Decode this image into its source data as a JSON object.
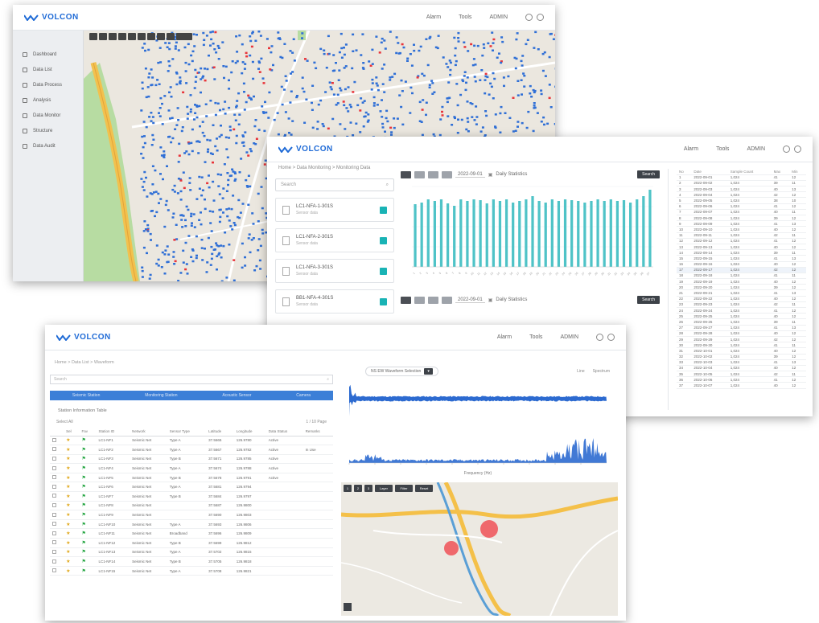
{
  "brand": {
    "logo_text": "VOLCON"
  },
  "header_links": [
    "Alarm",
    "Tools",
    "ADMIN"
  ],
  "window1": {
    "sidebar": [
      {
        "label": "Dashboard",
        "icon": "home-icon"
      },
      {
        "label": "Data List",
        "icon": "list-icon"
      },
      {
        "label": "Data Process",
        "icon": "process-icon"
      },
      {
        "label": "Analysis",
        "icon": "chart-icon"
      },
      {
        "label": "Data Monitor",
        "icon": "monitor-icon"
      },
      {
        "label": "Structure",
        "icon": "structure-icon"
      },
      {
        "label": "Data Audit",
        "icon": "audit-icon"
      }
    ]
  },
  "window2": {
    "breadcrumb": "Home  >  Data Monitoring  >  Monitoring Data",
    "search_placeholder": "Search",
    "cards": [
      {
        "title": "LC1-NFA-1-301S",
        "sub": "Sensor data"
      },
      {
        "title": "LC1-NFA-2-301S",
        "sub": "Sensor data"
      },
      {
        "title": "LC1-NFA-3-301S",
        "sub": "Sensor data"
      },
      {
        "title": "BB1-NFA-4-301S",
        "sub": "Sensor data"
      }
    ],
    "toolbar": {
      "select": "2022-09-01",
      "mode": "Daily Statistics",
      "button": "Search"
    },
    "toolbar2": {
      "select": "2022-09-01",
      "mode": "Daily Statistics",
      "button": "Search"
    },
    "table_headers": [
      "No",
      "Date",
      "Sample Count",
      "Max",
      "Min"
    ],
    "table_rows": [
      [
        "1",
        "2022-09-01",
        "1,024",
        "41",
        "12"
      ],
      [
        "2",
        "2022-09-02",
        "1,024",
        "39",
        "11"
      ],
      [
        "3",
        "2022-09-03",
        "1,024",
        "40",
        "13"
      ],
      [
        "4",
        "2022-09-04",
        "1,024",
        "42",
        "12"
      ],
      [
        "5",
        "2022-09-05",
        "1,024",
        "38",
        "10"
      ],
      [
        "6",
        "2022-09-06",
        "1,024",
        "41",
        "12"
      ],
      [
        "7",
        "2022-09-07",
        "1,024",
        "40",
        "11"
      ],
      [
        "8",
        "2022-09-08",
        "1,024",
        "39",
        "12"
      ],
      [
        "9",
        "2022-09-09",
        "1,024",
        "41",
        "13"
      ],
      [
        "10",
        "2022-09-10",
        "1,024",
        "40",
        "12"
      ],
      [
        "11",
        "2022-09-11",
        "1,024",
        "42",
        "11"
      ],
      [
        "12",
        "2022-09-12",
        "1,024",
        "41",
        "12"
      ],
      [
        "13",
        "2022-09-13",
        "1,024",
        "40",
        "12"
      ],
      [
        "14",
        "2022-09-14",
        "1,024",
        "39",
        "11"
      ],
      [
        "15",
        "2022-09-15",
        "1,024",
        "41",
        "13"
      ],
      [
        "16",
        "2022-09-16",
        "1,024",
        "40",
        "12"
      ],
      [
        "17",
        "2022-09-17",
        "1,024",
        "42",
        "12"
      ],
      [
        "18",
        "2022-09-18",
        "1,024",
        "41",
        "11"
      ],
      [
        "19",
        "2022-09-19",
        "1,024",
        "40",
        "12"
      ],
      [
        "20",
        "2022-09-20",
        "1,024",
        "39",
        "12"
      ],
      [
        "21",
        "2022-09-21",
        "1,024",
        "41",
        "13"
      ],
      [
        "22",
        "2022-09-22",
        "1,024",
        "40",
        "12"
      ],
      [
        "23",
        "2022-09-23",
        "1,024",
        "42",
        "11"
      ],
      [
        "24",
        "2022-09-24",
        "1,024",
        "41",
        "12"
      ],
      [
        "25",
        "2022-09-25",
        "1,024",
        "40",
        "12"
      ],
      [
        "26",
        "2022-09-26",
        "1,024",
        "39",
        "11"
      ],
      [
        "27",
        "2022-09-27",
        "1,024",
        "41",
        "13"
      ],
      [
        "28",
        "2022-09-28",
        "1,024",
        "40",
        "12"
      ],
      [
        "29",
        "2022-09-29",
        "1,024",
        "42",
        "12"
      ],
      [
        "30",
        "2022-09-30",
        "1,024",
        "41",
        "11"
      ],
      [
        "31",
        "2022-10-01",
        "1,024",
        "40",
        "12"
      ],
      [
        "32",
        "2022-10-02",
        "1,024",
        "39",
        "12"
      ],
      [
        "33",
        "2022-10-03",
        "1,024",
        "41",
        "13"
      ],
      [
        "34",
        "2022-10-04",
        "1,024",
        "40",
        "12"
      ],
      [
        "35",
        "2022-10-05",
        "1,024",
        "42",
        "11"
      ],
      [
        "36",
        "2022-10-06",
        "1,024",
        "41",
        "12"
      ],
      [
        "37",
        "2022-10-07",
        "1,024",
        "40",
        "12"
      ]
    ]
  },
  "chart_data": {
    "type": "bar",
    "categories": [
      "1",
      "2",
      "3",
      "4",
      "5",
      "6",
      "7",
      "8",
      "9",
      "10",
      "11",
      "12",
      "13",
      "14",
      "15",
      "16",
      "17",
      "18",
      "19",
      "20",
      "21",
      "22",
      "23",
      "24",
      "25",
      "26",
      "27",
      "28",
      "29",
      "30",
      "31",
      "32",
      "33",
      "34",
      "35",
      "36",
      "37"
    ],
    "values": [
      78,
      80,
      84,
      82,
      84,
      79,
      76,
      84,
      82,
      84,
      83,
      79,
      84,
      82,
      84,
      80,
      82,
      84,
      88,
      82,
      80,
      84,
      82,
      84,
      83,
      82,
      80,
      82,
      84,
      82,
      84,
      82,
      83,
      80,
      84,
      88,
      96
    ],
    "ylim": [
      0,
      100
    ],
    "color": "#4fc3c7"
  },
  "window3": {
    "breadcrumb": "Home  >  Data List  >  Waveform",
    "search_placeholder": "Search",
    "tabs": [
      "Seismic Station",
      "Monitoring Station",
      "Acoustic Sensor",
      "Camera"
    ],
    "section_title": "Station Information Table",
    "tools": {
      "left": "Select All",
      "right": "1 / 10 Page"
    },
    "table_headers": [
      "",
      "Sel",
      "Fav",
      "Station ID",
      "Network",
      "Sensor Type",
      "Latitude",
      "Longitude",
      "Data Status",
      "Remarks"
    ],
    "table_rows": [
      [
        "LC1-NF1",
        "Seismic Net",
        "Type A",
        "37.5665",
        "126.9780",
        "Active",
        ""
      ],
      [
        "LC1-NF2",
        "Seismic Net",
        "Type A",
        "37.5667",
        "126.9782",
        "Active",
        "In Use"
      ],
      [
        "LC1-NF3",
        "Seismic Net",
        "Type B",
        "37.5671",
        "126.9785",
        "Active",
        ""
      ],
      [
        "LC1-NF4",
        "Seismic Net",
        "Type A",
        "37.5674",
        "126.9788",
        "Active",
        ""
      ],
      [
        "LC1-NF5",
        "Seismic Net",
        "Type B",
        "37.5678",
        "126.9791",
        "Active",
        ""
      ],
      [
        "LC1-NF6",
        "Seismic Net",
        "Type A",
        "37.5681",
        "126.9794",
        "",
        ""
      ],
      [
        "LC1-NF7",
        "Seismic Net",
        "Type B",
        "37.5684",
        "126.9797",
        "",
        ""
      ],
      [
        "LC1-NF8",
        "Seismic Net",
        "",
        "37.5687",
        "126.9800",
        "",
        ""
      ],
      [
        "LC1-NF9",
        "Seismic Net",
        "",
        "37.5690",
        "126.9803",
        "",
        ""
      ],
      [
        "LC1-NF10",
        "Seismic Net",
        "Type A",
        "37.5693",
        "126.9806",
        "",
        ""
      ],
      [
        "LC1-NF11",
        "Seismic Net",
        "Broadband",
        "37.5696",
        "126.9809",
        "",
        ""
      ],
      [
        "LC1-NF12",
        "Seismic Net",
        "Type B",
        "37.5699",
        "126.9812",
        "",
        ""
      ],
      [
        "LC1-NF13",
        "Seismic Net",
        "Type A",
        "37.5702",
        "126.9815",
        "",
        ""
      ],
      [
        "LC1-NF14",
        "Seismic Net",
        "Type B",
        "37.5705",
        "126.9818",
        "",
        ""
      ],
      [
        "LC1-NF15",
        "Seismic Net",
        "Type A",
        "37.5708",
        "126.9821",
        "",
        ""
      ]
    ],
    "wave": {
      "selector": "NS  EW  Waveform Selection",
      "legend": [
        "Line",
        "Spectrum"
      ],
      "xlabel": "Frequency (Hz)"
    },
    "map_tools": [
      "1",
      "2",
      "3",
      "Layer",
      "Filter",
      "Reset"
    ]
  }
}
